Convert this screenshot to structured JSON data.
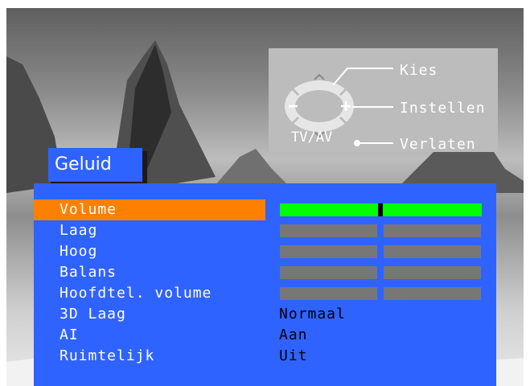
{
  "help_box": {
    "kies_label": "Kies",
    "instellen_label": "Instellen",
    "verlaten_label": "Verlaten",
    "tvav_label": "TV/AV"
  },
  "menu": {
    "title": "Geluid",
    "items": [
      {
        "label": "Volume",
        "selected": true,
        "slider": 0.5
      },
      {
        "label": "Laag",
        "slider": 0.5
      },
      {
        "label": "Hoog",
        "slider": 0.5
      },
      {
        "label": "Balans",
        "slider": 0.5
      },
      {
        "label": "Hoofdtel. volume",
        "slider": 0.5
      },
      {
        "label": "3D Laag",
        "value": "Normaal"
      },
      {
        "label": "AI",
        "value": "Aan"
      },
      {
        "label": "Ruimtelijk",
        "value": "Uit"
      }
    ]
  },
  "colors": {
    "menu_bg": "#2f63ff",
    "highlight": "#ff7f00",
    "slider_active": "#00ff00",
    "slider_inactive": "#777777"
  }
}
